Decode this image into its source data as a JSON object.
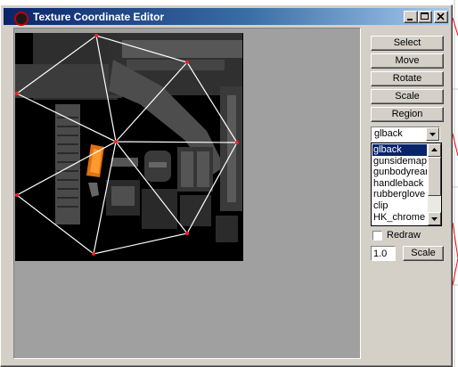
{
  "window": {
    "title": "Texture Coordinate Editor",
    "title_buttons": [
      "minimize",
      "maximize",
      "close"
    ]
  },
  "tools": {
    "select_label": "Select",
    "move_label": "Move",
    "rotate_label": "Rotate",
    "scale_label": "Scale",
    "region_label": "Region"
  },
  "mesh_group": {
    "selected": "glback",
    "options": [
      "glback",
      "gunsidemap",
      "gunbodyrear",
      "handleback",
      "rubberglove",
      "clip",
      "HK_chrome"
    ],
    "selected_index": 0
  },
  "redraw": {
    "label": "Redraw",
    "checked": false
  },
  "scale_control": {
    "value": "1.0",
    "button_label": "Scale"
  },
  "colors": {
    "title_active": "#0a246a",
    "selection": "#0a246a",
    "uv_edges": "#ffffff",
    "uv_vertices": "#ff0000",
    "client_bg": "#a0a0a0",
    "face": "#d4d0c8"
  },
  "icons": [
    "app-icon",
    "minimize-icon",
    "maximize-icon",
    "close-icon",
    "dropdown-arrow-icon",
    "scroll-up-icon",
    "scroll-down-icon"
  ]
}
